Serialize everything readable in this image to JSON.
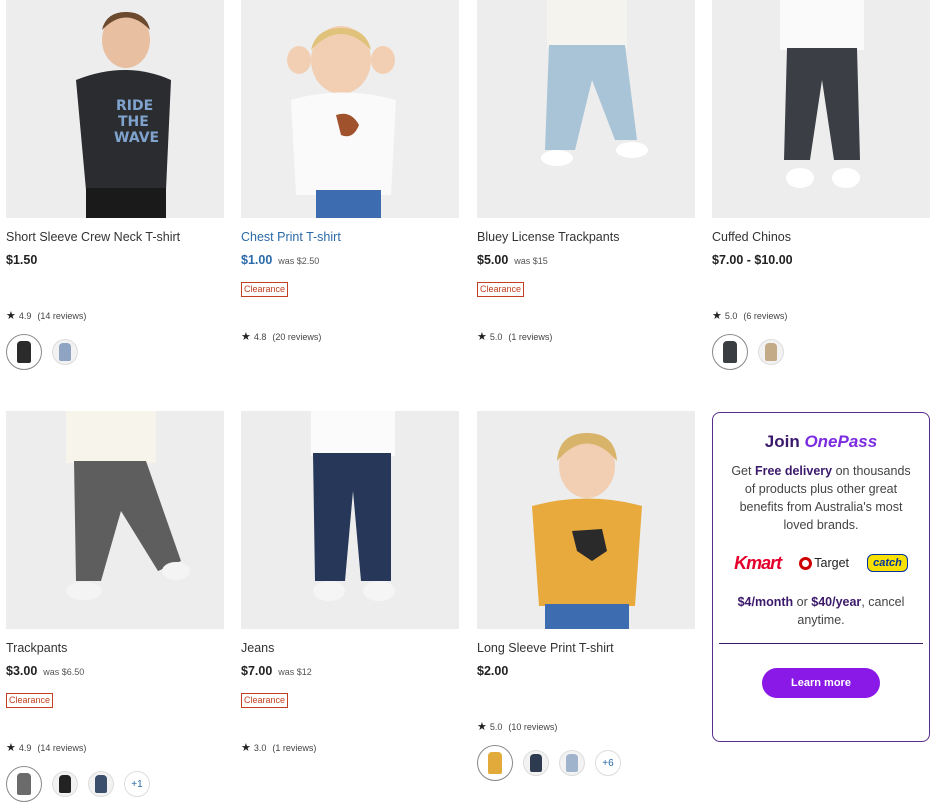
{
  "products": [
    {
      "title": "Short Sleeve Crew Neck T-shirt",
      "price": "$1.50",
      "was": "",
      "badge": "",
      "rating": "4.9",
      "reviews": "(14 reviews)",
      "swatch_colors": [
        "#2b2b2b",
        "#8fa3c2"
      ],
      "more": ""
    },
    {
      "title": "Chest Print T-shirt",
      "price": "$1.00",
      "was": "was $2.50",
      "badge": "Clearance",
      "rating": "4.8",
      "reviews": "(20 reviews)",
      "swatch_colors": [],
      "more": ""
    },
    {
      "title": "Bluey License Trackpants",
      "price": "$5.00",
      "was": "was $15",
      "badge": "Clearance",
      "rating": "5.0",
      "reviews": "(1 reviews)",
      "swatch_colors": [],
      "more": ""
    },
    {
      "title": "Cuffed Chinos",
      "price": "$7.00 - $10.00",
      "was": "",
      "badge": "",
      "rating": "5.0",
      "reviews": "(6 reviews)",
      "swatch_colors": [
        "#3a3d42",
        "#c2ab86"
      ],
      "more": ""
    },
    {
      "title": "Trackpants",
      "price": "$3.00",
      "was": "was $6.50",
      "badge": "Clearance",
      "rating": "4.9",
      "reviews": "(14 reviews)",
      "swatch_colors": [
        "#6b6b6b",
        "#222222",
        "#3b4e6b"
      ],
      "more": "+1"
    },
    {
      "title": "Jeans",
      "price": "$7.00",
      "was": "was $12",
      "badge": "Clearance",
      "rating": "3.0",
      "reviews": "(1 reviews)",
      "swatch_colors": [],
      "more": ""
    },
    {
      "title": "Long Sleeve Print T-shirt",
      "price": "$2.00",
      "was": "",
      "badge": "",
      "rating": "5.0",
      "reviews": "(10 reviews)",
      "swatch_colors": [
        "#e2a93b",
        "#2d3a4f",
        "#9fb4cc"
      ],
      "more": "+6"
    }
  ],
  "promo": {
    "join": "Join",
    "brand": "OnePass",
    "desc_pre": "Get",
    "desc_bold": "Free delivery",
    "desc_post": "on thousands of products plus other great benefits from Australia's most loved brands.",
    "brand_kmart": "Kmart",
    "brand_target": "Target",
    "brand_catch": "catch",
    "price_month": "$4/month",
    "price_or": "or",
    "price_year": "$40/year",
    "price_tail": ", cancel anytime.",
    "button": "Learn more"
  },
  "colors": {
    "accent": "#8a18e6",
    "promo_border": "#5a2e8c",
    "clearance": "#c0401f",
    "link": "#2a6aa8"
  },
  "icons": {
    "rating": "star-icon"
  }
}
